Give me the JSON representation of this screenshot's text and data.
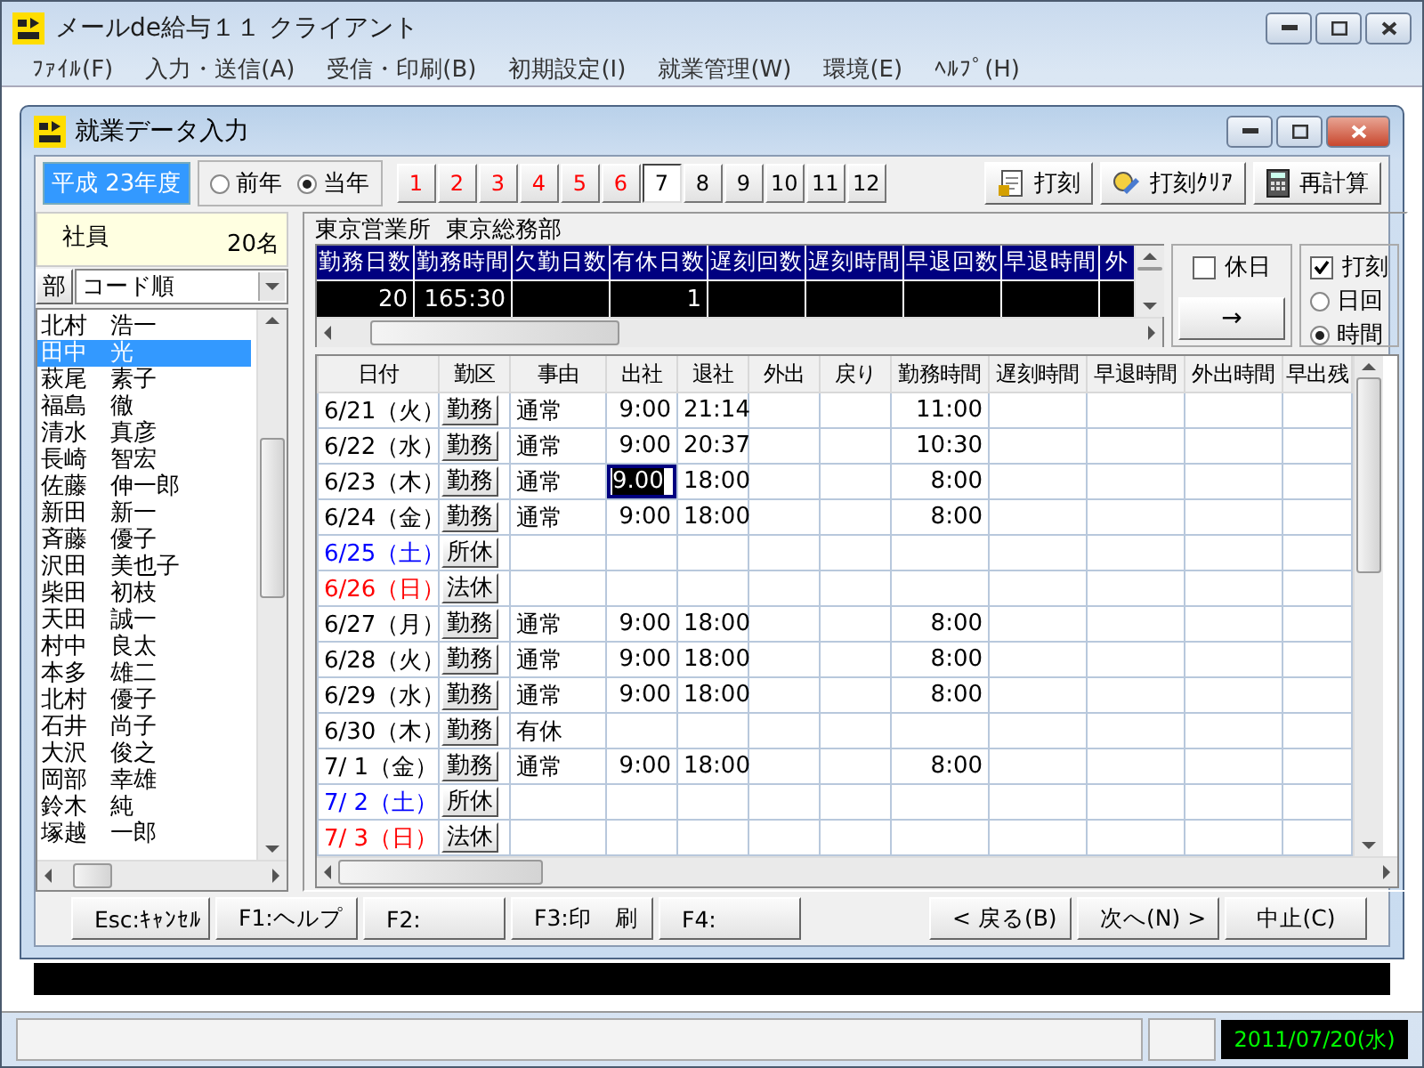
{
  "app_window": {
    "title": "メールde給与１１ クライアント"
  },
  "menu": [
    "ﾌｧｲﾙ(F)",
    "入力・送信(A)",
    "受信・印刷(B)",
    "初期設定(I)",
    "就業管理(W)",
    "環境(E)",
    "ﾍﾙﾌﾟ(H)"
  ],
  "child_window": {
    "title": "就業データ入力"
  },
  "fiscal_year": "平成 23年度",
  "year_options": [
    {
      "label": "前年",
      "selected": false
    },
    {
      "label": "当年",
      "selected": true
    }
  ],
  "months": [
    {
      "label": "1",
      "color": "#ff0000",
      "selected": false
    },
    {
      "label": "2",
      "color": "#ff0000",
      "selected": false
    },
    {
      "label": "3",
      "color": "#ff0000",
      "selected": false
    },
    {
      "label": "4",
      "color": "#ff0000",
      "selected": false
    },
    {
      "label": "5",
      "color": "#ff0000",
      "selected": false
    },
    {
      "label": "6",
      "color": "#ff0000",
      "selected": false
    },
    {
      "label": "7",
      "color": "#000000",
      "selected": true
    },
    {
      "label": "8",
      "color": "#000000",
      "selected": false
    },
    {
      "label": "9",
      "color": "#000000",
      "selected": false
    },
    {
      "label": "10",
      "color": "#000000",
      "selected": false
    },
    {
      "label": "11",
      "color": "#000000",
      "selected": false
    },
    {
      "label": "12",
      "color": "#000000",
      "selected": false
    }
  ],
  "tools": [
    {
      "label": "打刻",
      "kind": "stamp"
    },
    {
      "label": "打刻ｸﾘｱ",
      "kind": "clear"
    },
    {
      "label": "再計算",
      "kind": "calculator"
    }
  ],
  "employees": {
    "heading": "社員",
    "count": "20名",
    "dept_button": "部",
    "sort": "コード順",
    "items": [
      {
        "name": "北村　浩一",
        "selected": false
      },
      {
        "name": "田中　光",
        "selected": true
      },
      {
        "name": "萩尾　素子",
        "selected": false
      },
      {
        "name": "福島　徹",
        "selected": false
      },
      {
        "name": "清水　真彦",
        "selected": false
      },
      {
        "name": "長崎　智宏",
        "selected": false
      },
      {
        "name": "佐藤　伸一郎",
        "selected": false
      },
      {
        "name": "新田　新一",
        "selected": false
      },
      {
        "name": "斉藤　優子",
        "selected": false
      },
      {
        "name": "沢田　美也子",
        "selected": false
      },
      {
        "name": "柴田　初枝",
        "selected": false
      },
      {
        "name": "天田　誠一",
        "selected": false
      },
      {
        "name": "村中　良太",
        "selected": false
      },
      {
        "name": "本多　雄二",
        "selected": false
      },
      {
        "name": "北村　優子",
        "selected": false
      },
      {
        "name": "石井　尚子",
        "selected": false
      },
      {
        "name": "大沢　俊之",
        "selected": false
      },
      {
        "name": "岡部　幸雄",
        "selected": false
      },
      {
        "name": "鈴木　純",
        "selected": false
      },
      {
        "name": "塚越　一郎",
        "selected": false
      }
    ]
  },
  "department": "東京営業所  東京総務部",
  "summary": [
    {
      "label": "勤務日数",
      "value": "20"
    },
    {
      "label": "勤務時間",
      "value": "165:30"
    },
    {
      "label": "欠勤日数"
    },
    {
      "label": "有休日数",
      "value": "1"
    },
    {
      "label": "遅刻回数"
    },
    {
      "label": "遅刻時間"
    },
    {
      "label": "早退回数"
    },
    {
      "label": "早退時間"
    },
    {
      "label": "外"
    }
  ],
  "options": {
    "holiday": {
      "label": "休日",
      "checked": false
    },
    "arrow_button": "→",
    "stamp": {
      "label": "打刻",
      "checked": true
    },
    "modes": [
      {
        "label": "日回",
        "selected": false
      },
      {
        "label": "時間",
        "selected": true
      }
    ]
  },
  "table": {
    "columns": [
      "日付",
      "勤区",
      "事由",
      "出社",
      "退社",
      "外出",
      "戻り",
      "勤務時間",
      "遅刻時間",
      "早退時間",
      "外出時間",
      "早出残"
    ],
    "rows": [
      {
        "date": "6/21（火）",
        "color": "#000000",
        "ward": "勤務",
        "reason": "通常",
        "in": "9:00",
        "out": "21:14",
        "work": "11:00",
        "editing": false
      },
      {
        "date": "6/22（水）",
        "color": "#000000",
        "ward": "勤務",
        "reason": "通常",
        "in": "9:00",
        "out": "20:37",
        "work": "10:30",
        "editing": false
      },
      {
        "date": "6/23（木）",
        "color": "#000000",
        "ward": "勤務",
        "reason": "通常",
        "in": "9.00",
        "out": "18:00",
        "work": "8:00",
        "editing": true
      },
      {
        "date": "6/24（金）",
        "color": "#000000",
        "ward": "勤務",
        "reason": "通常",
        "in": "9:00",
        "out": "18:00",
        "work": "8:00",
        "editing": false
      },
      {
        "date": "6/25（土）",
        "color": "#0000ff",
        "ward": "所休",
        "editing": false
      },
      {
        "date": "6/26（日）",
        "color": "#ff0000",
        "ward": "法休",
        "editing": false
      },
      {
        "date": "6/27（月）",
        "color": "#000000",
        "ward": "勤務",
        "reason": "通常",
        "in": "9:00",
        "out": "18:00",
        "work": "8:00",
        "editing": false
      },
      {
        "date": "6/28（火）",
        "color": "#000000",
        "ward": "勤務",
        "reason": "通常",
        "in": "9:00",
        "out": "18:00",
        "work": "8:00",
        "editing": false
      },
      {
        "date": "6/29（水）",
        "color": "#000000",
        "ward": "勤務",
        "reason": "通常",
        "in": "9:00",
        "out": "18:00",
        "work": "8:00",
        "editing": false
      },
      {
        "date": "6/30（木）",
        "color": "#000000",
        "ward": "勤務",
        "reason": "有休",
        "editing": false
      },
      {
        "date": "7/ 1（金）",
        "color": "#000000",
        "ward": "勤務",
        "reason": "通常",
        "in": "9:00",
        "out": "18:00",
        "work": "8:00",
        "editing": false
      },
      {
        "date": "7/ 2（土）",
        "color": "#0000ff",
        "ward": "所休",
        "editing": false
      },
      {
        "date": "7/ 3（日）",
        "color": "#ff0000",
        "ward": "法休",
        "editing": false
      }
    ]
  },
  "function_keys": [
    "Esc:ｷｬﾝｾﾙ",
    "F1:ヘルプ",
    "F2:",
    "F3:印　刷",
    "F4:"
  ],
  "nav_buttons": [
    "< 戻る(B)",
    "次へ(N) >",
    "中止(C)"
  ],
  "status_bar": {
    "date": "2011/07/20(水)"
  }
}
